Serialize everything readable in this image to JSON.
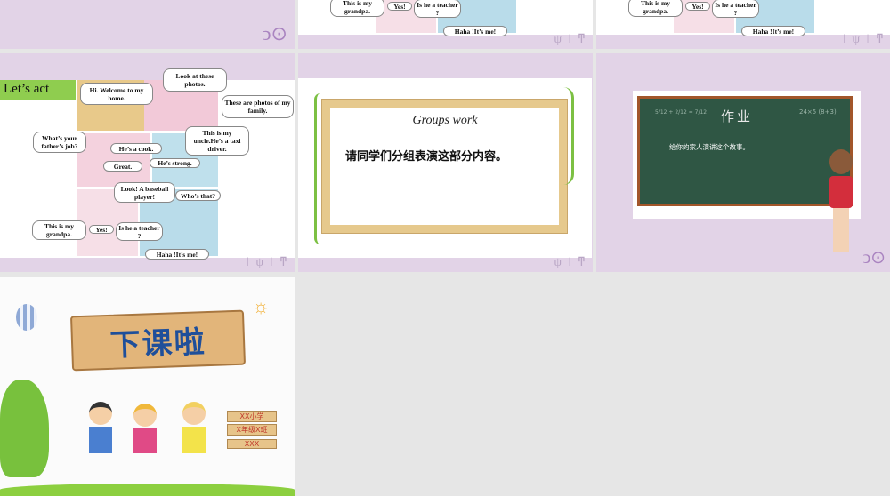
{
  "comic": {
    "title": "Let’s act",
    "bubbles": {
      "welcome": "Hi. Welcome to my home.",
      "look": "Look at these photos.",
      "photos": "These are photos of my family.",
      "job": "What’s your father’s job?",
      "cook": "He’s a cook.",
      "uncle": "This is my uncle.He’s a taxi driver.",
      "great": "Great.",
      "strong": "He’s strong.",
      "baseball": "Look! A baseball player!",
      "who": "Who’s that?",
      "grandpa": "This is my grandpa.",
      "yes": "Yes!",
      "teacher": "Is he a teacher ?",
      "haha": "Haha !It’s me!"
    }
  },
  "groups": {
    "title": "Groups work",
    "text": "请同学们分组表演这部分内容。"
  },
  "homework": {
    "title": "作业",
    "text": "给你的家人演讲这个故事。",
    "math1": "5/12 + 2/12 = 7/12",
    "math2": "24×5 (8+3)"
  },
  "ending": {
    "title": "下课啦",
    "sign1": "XX小学",
    "sign2": "X年级X班",
    "sign3": "XXX"
  }
}
